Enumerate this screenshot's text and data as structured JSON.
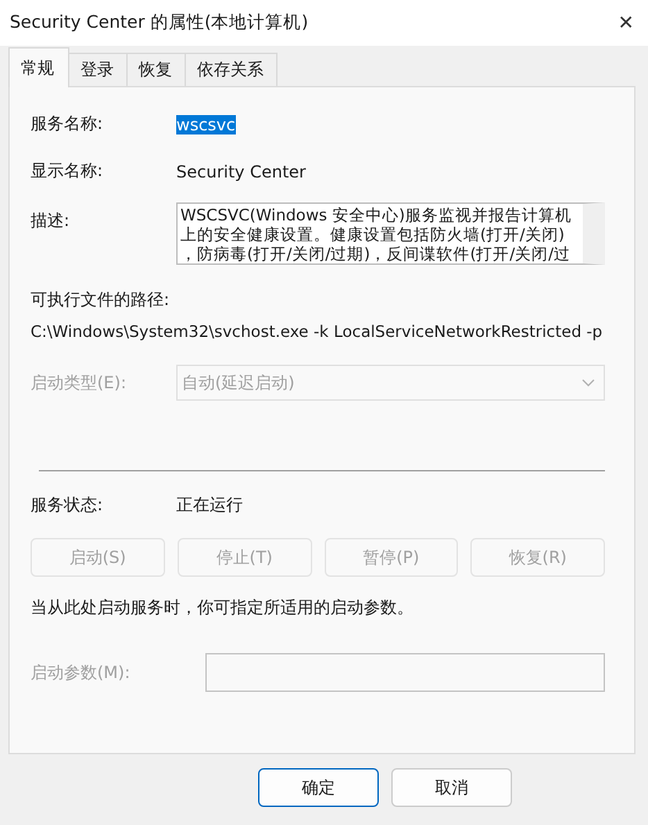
{
  "window": {
    "title": "Security Center 的属性(本地计算机)",
    "close": "✕"
  },
  "tabs": [
    {
      "label": "常规",
      "selected": true
    },
    {
      "label": "登录",
      "selected": false
    },
    {
      "label": "恢复",
      "selected": false
    },
    {
      "label": "依存关系",
      "selected": false
    }
  ],
  "service_name": {
    "label": "服务名称:",
    "value": "wscsvc",
    "selected": true
  },
  "display_name": {
    "label": "显示名称:",
    "value": "Security Center"
  },
  "description": {
    "label": "描述:",
    "lines": [
      "WSCSVC(Windows 安全中心)服务监视并报告计算机",
      "上的安全健康设置。健康设置包括防火墙(打开/关闭)",
      "，防病毒(打开/关闭/过期)，反间谍软件(打开/关闭/过"
    ]
  },
  "executable_path": {
    "label": "可执行文件的路径:",
    "value": "C:\\Windows\\System32\\svchost.exe -k LocalServiceNetworkRestricted -p"
  },
  "startup_type": {
    "label": "启动类型(E):",
    "value": "自动(延迟启动)",
    "disabled": true
  },
  "service_status": {
    "label": "服务状态:",
    "value": "正在运行"
  },
  "service_buttons": [
    {
      "label": "启动(S)",
      "disabled": true
    },
    {
      "label": "停止(T)",
      "disabled": true
    },
    {
      "label": "暂停(P)",
      "disabled": true
    },
    {
      "label": "恢复(R)",
      "disabled": true
    }
  ],
  "hint": "当从此处启动服务时，你可指定所适用的启动参数。",
  "start_parameters": {
    "label": "启动参数(M):",
    "disabled": true
  },
  "buttons": [
    {
      "label": "确定",
      "default": true
    },
    {
      "label": "取消",
      "default": false
    }
  ]
}
